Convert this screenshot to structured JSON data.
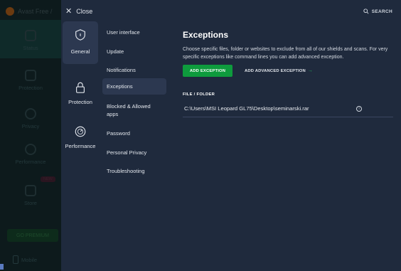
{
  "background": {
    "brand": "Avast Free /",
    "nav": [
      {
        "label": "Status"
      },
      {
        "label": "Protection"
      },
      {
        "label": "Privacy"
      },
      {
        "label": "Performance"
      },
      {
        "label": "Store",
        "badge": "NEW"
      }
    ],
    "premium_label": "GO PREMIUM",
    "mobile_label": "Mobile"
  },
  "topbar": {
    "close_label": "Close",
    "search_label": "SEARCH"
  },
  "categories": [
    {
      "label": "General",
      "icon": "shield-icon"
    },
    {
      "label": "Protection",
      "icon": "lock-icon"
    },
    {
      "label": "Performance",
      "icon": "speedometer-icon"
    }
  ],
  "submenu": [
    {
      "label": "User interface"
    },
    {
      "label": "Update"
    },
    {
      "label": "Notifications"
    },
    {
      "label": "Exceptions"
    },
    {
      "label": "Blocked & Allowed apps"
    },
    {
      "label": "Password"
    },
    {
      "label": "Personal Privacy"
    },
    {
      "label": "Troubleshooting"
    }
  ],
  "content": {
    "title": "Exceptions",
    "description": "Choose specific files, folder or websites to exclude from all of our shields and scans. For very specific exceptions like command lines you can add advanced exception.",
    "add_button": "ADD EXCEPTION",
    "advanced_button": "ADD ADVANCED EXCEPTION",
    "column_header": "FILE / FOLDER",
    "exceptions": [
      {
        "path": "C:\\Users\\MSI Leopard GL75\\Desktop\\seminarski.rar"
      }
    ]
  },
  "colors": {
    "panel": "#1f2a3d",
    "active": "#2c3850",
    "accent_green": "#0e9b3d"
  }
}
